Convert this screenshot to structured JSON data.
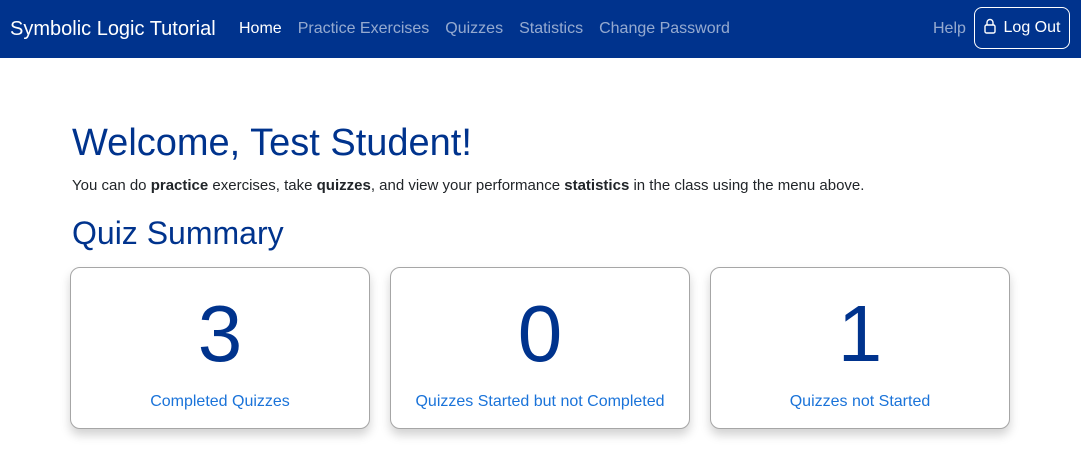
{
  "navbar": {
    "brand": "Symbolic Logic Tutorial",
    "links": [
      {
        "label": "Home",
        "active": true
      },
      {
        "label": "Practice Exercises",
        "active": false
      },
      {
        "label": "Quizzes",
        "active": false
      },
      {
        "label": "Statistics",
        "active": false
      },
      {
        "label": "Change Password",
        "active": false
      }
    ],
    "help_label": "Help",
    "logout_label": "Log Out",
    "logout_icon": "lock-icon",
    "background_color": "#00338d"
  },
  "main": {
    "welcome": "Welcome, Test Student!",
    "intro": {
      "t1": "You can do ",
      "b1": "practice",
      "t2": " exercises, take ",
      "b2": "quizzes",
      "t3": ", and view your performance ",
      "b3": "statistics",
      "t4": " in the class using the menu above."
    },
    "summary_title": "Quiz Summary",
    "cards": [
      {
        "count": "3",
        "label": "Completed Quizzes"
      },
      {
        "count": "0",
        "label": "Quizzes Started but not Completed"
      },
      {
        "count": "1",
        "label": "Quizzes not Started"
      }
    ],
    "accent_color": "#00338d",
    "link_color": "#1a73d9"
  }
}
